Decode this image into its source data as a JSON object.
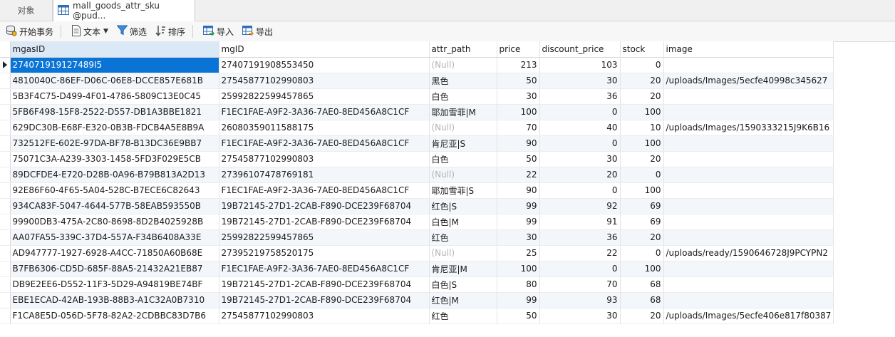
{
  "tabs": {
    "objects": "对象",
    "active": "mall_goods_attr_sku @pud..."
  },
  "toolbar": {
    "begin_tx": "开始事务",
    "text": "文本",
    "filter": "筛选",
    "sort": "排序",
    "import": "导入",
    "export": "导出"
  },
  "grid": {
    "columns": [
      "mgasID",
      "mgID",
      "attr_path",
      "price",
      "discount_price",
      "stock",
      "image"
    ],
    "rows": [
      [
        "274071919127489I5",
        "27407191908553450",
        "(Null)",
        "213",
        "103",
        "0",
        ""
      ],
      [
        "4810040C-86EF-D06C-06E8-DCCE857E681B",
        "27545877102990803",
        "黑色",
        "50",
        "30",
        "20",
        "/uploads/Images/5ecfe40998c345627"
      ],
      [
        "5B3F4C75-D499-4F01-4786-5809C13E0C45",
        "25992822599457865",
        "白色",
        "30",
        "36",
        "20",
        ""
      ],
      [
        "5FB6F498-15F8-2522-D557-DB1A3BBE1821",
        "F1EC1FAE-A9F2-3A36-7AE0-8ED456A8C1CF",
        "耶加雪菲|M",
        "100",
        "0",
        "100",
        ""
      ],
      [
        "629DC30B-E68F-E320-0B3B-FDCB4A5E8B9A",
        "26080359011588175",
        "(Null)",
        "70",
        "40",
        "10",
        "/uploads/Images/1590333215J9K6B16"
      ],
      [
        "732512FE-602E-97DA-BF78-B13DC36E9BB7",
        "F1EC1FAE-A9F2-3A36-7AE0-8ED456A8C1CF",
        "肯尼亚|S",
        "90",
        "0",
        "100",
        ""
      ],
      [
        "75071C3A-A239-3303-1458-5FD3F029E5CB",
        "27545877102990803",
        "白色",
        "50",
        "30",
        "20",
        ""
      ],
      [
        "89DCFDE4-E720-D28B-0A96-B79B813A2D13",
        "27396107478769181",
        "(Null)",
        "22",
        "20",
        "0",
        ""
      ],
      [
        "92E86F60-4F65-5A04-528C-B7ECE6C82643",
        "F1EC1FAE-A9F2-3A36-7AE0-8ED456A8C1CF",
        "耶加雪菲|S",
        "90",
        "0",
        "100",
        ""
      ],
      [
        "934CA83F-5047-4644-577B-58EAB593550B",
        "19B72145-27D1-2CAB-F890-DCE239F68704",
        "红色|S",
        "99",
        "92",
        "69",
        ""
      ],
      [
        "99900DB3-475A-2C80-8698-8D2B4025928B",
        "19B72145-27D1-2CAB-F890-DCE239F68704",
        "白色|M",
        "99",
        "91",
        "69",
        ""
      ],
      [
        "AA07FA55-339C-37D4-557A-F34B6408A33E",
        "25992822599457865",
        "红色",
        "30",
        "36",
        "20",
        ""
      ],
      [
        "AD947777-1927-6928-A4CC-71850A60B68E",
        "27395219758520175",
        "(Null)",
        "25",
        "22",
        "0",
        "/uploads/ready/1590646728J9PCYPN2"
      ],
      [
        "B7FB6306-CD5D-685F-88A5-21432A21EB87",
        "F1EC1FAE-A9F2-3A36-7AE0-8ED456A8C1CF",
        "肯尼亚|M",
        "100",
        "0",
        "100",
        ""
      ],
      [
        "DB9E2EE6-D552-11F3-5D29-A94819BE74BF",
        "19B72145-27D1-2CAB-F890-DCE239F68704",
        "白色|S",
        "80",
        "70",
        "68",
        ""
      ],
      [
        "EBE1ECAD-42AB-193B-88B3-A1C32A0B7310",
        "19B72145-27D1-2CAB-F890-DCE239F68704",
        "红色|M",
        "99",
        "93",
        "68",
        ""
      ],
      [
        "F1CA8E5D-056D-5F78-82A2-2CDBBC83D7B6",
        "27545877102990803",
        "红色",
        "50",
        "30",
        "20",
        "/uploads/Images/5ecfe406e817f80387"
      ]
    ]
  }
}
